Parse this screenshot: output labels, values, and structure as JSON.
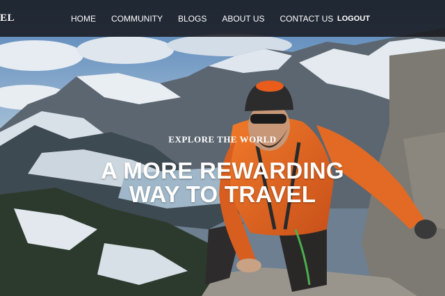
{
  "site": {
    "logo_text": "EL"
  },
  "nav": {
    "items": [
      {
        "label": "HOME"
      },
      {
        "label": "COMMUNITY"
      },
      {
        "label": "BLOGS"
      },
      {
        "label": "ABOUT US"
      },
      {
        "label": "CONTACT US"
      }
    ],
    "logout_label": "LOGOUT"
  },
  "hero": {
    "eyebrow": "EXPLORE THE WORLD",
    "headline_line1": "A MORE REWARDING",
    "headline_line2": "WAY TO TRAVEL",
    "image_subject": "mountaineer-photo"
  }
}
